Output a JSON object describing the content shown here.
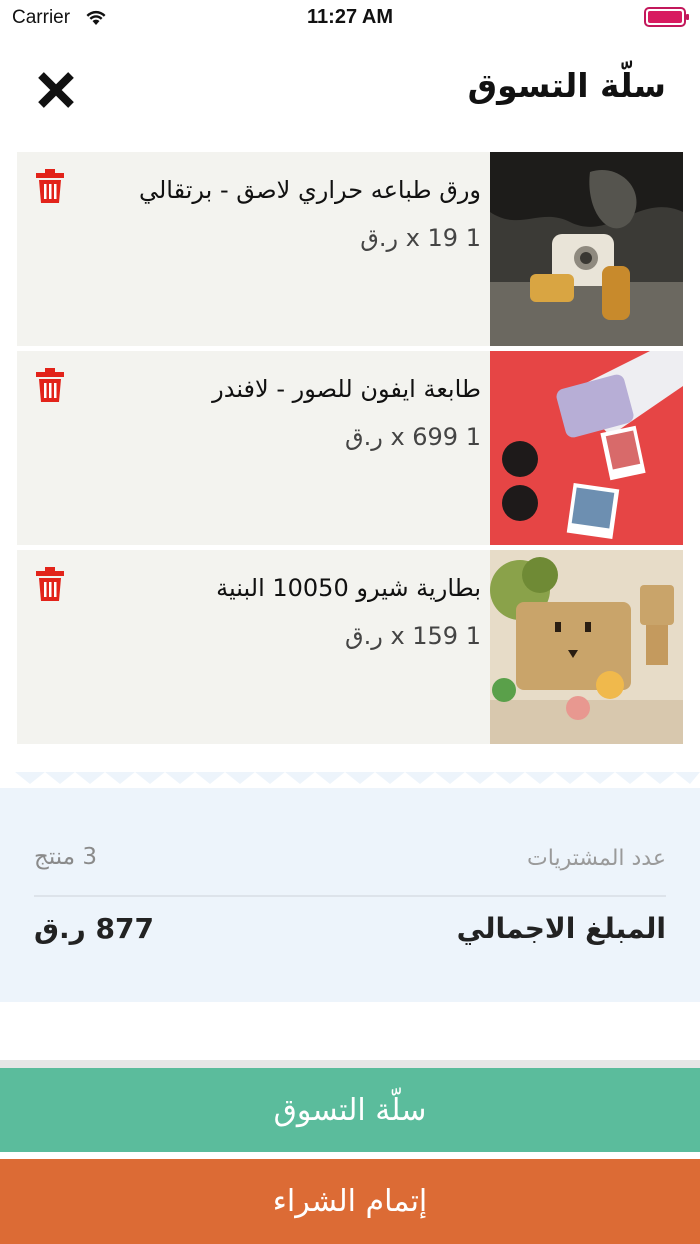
{
  "status_bar": {
    "carrier": "Carrier",
    "time": "11:27 AM"
  },
  "header": {
    "title": "سلّة التسوق"
  },
  "cart": {
    "items": [
      {
        "name": "ورق طباعه حراري لاصق - برتقالي",
        "qty_price": "1 x 19 ر.ق"
      },
      {
        "name": "طابعة ايفون للصور - لافندر",
        "qty_price": "1 x 699 ر.ق"
      },
      {
        "name": "بطارية شيرو 10050 البنية",
        "qty_price": "1 x 159 ر.ق"
      }
    ]
  },
  "summary": {
    "count_label": "عدد المشتريات",
    "count_value": "3 منتج",
    "total_label": "المبلغ الاجمالي",
    "total_value": "877 ر.ق"
  },
  "footer": {
    "cart_label": "سلّة التسوق",
    "checkout_label": "إتمام الشراء"
  },
  "colors": {
    "accent_green": "#5bbc9c",
    "accent_orange": "#dc6b35",
    "delete_red": "#e2231a",
    "summary_bg": "#edf4fb"
  }
}
